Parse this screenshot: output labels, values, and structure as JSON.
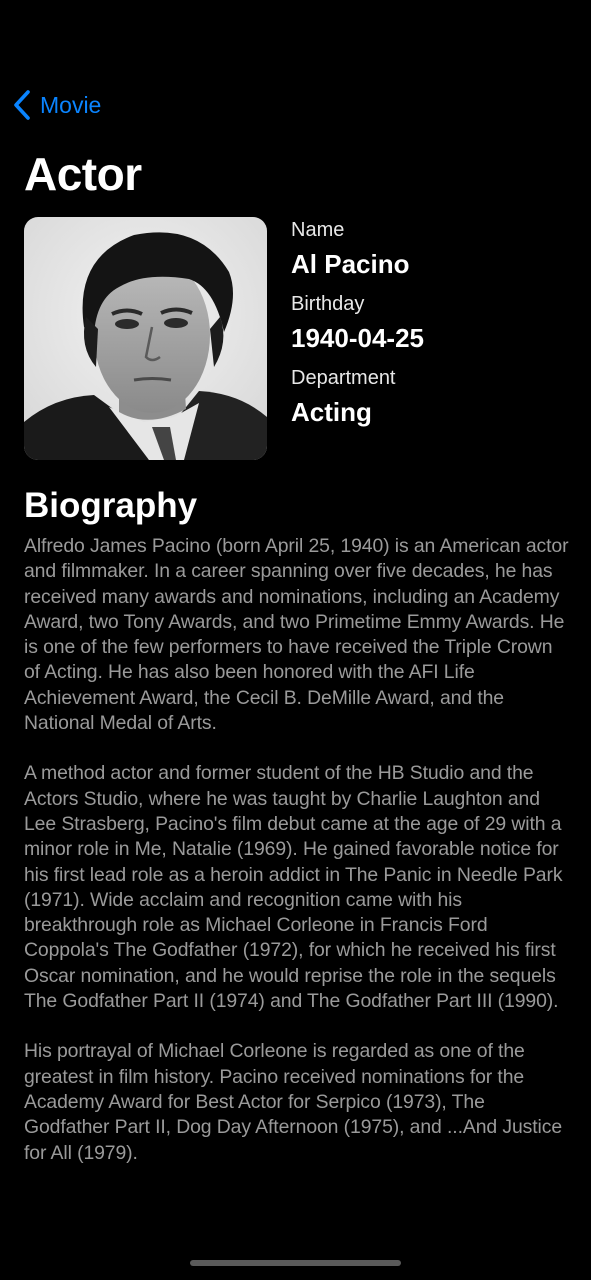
{
  "nav": {
    "back_label": "Movie"
  },
  "page": {
    "title": "Actor"
  },
  "actor": {
    "photo_alt": "Al Pacino",
    "name_label": "Name",
    "name": "Al Pacino",
    "birthday_label": "Birthday",
    "birthday": "1940-04-25",
    "department_label": "Department",
    "department": "Acting"
  },
  "biography": {
    "heading": "Biography",
    "paragraphs": [
      "Alfredo James Pacino (born April 25, 1940) is an American actor and filmmaker. In a career spanning over five decades, he has received many awards and nominations, including an Academy Award, two Tony Awards, and two Primetime Emmy Awards. He is one of the few performers to have received the Triple Crown of Acting. He has also been honored with the AFI Life Achievement Award, the Cecil B. DeMille Award, and the National Medal of Arts.",
      "A method actor and former student of the HB Studio and the Actors Studio, where he was taught by Charlie Laughton and Lee Strasberg, Pacino's film debut came at the age of 29 with a minor role in Me, Natalie (1969). He gained favorable notice for his first lead role as a heroin addict in The Panic in Needle Park (1971). Wide acclaim and recognition came with his breakthrough role as Michael Corleone in Francis Ford Coppola's The Godfather (1972), for which he received his first Oscar nomination, and he would reprise the role in the sequels The Godfather Part II (1974) and The Godfather Part III (1990).",
      "His portrayal of Michael Corleone is regarded as one of the greatest in film history. Pacino received nominations for the Academy Award for Best Actor for Serpico (1973), The Godfather Part II, Dog Day Afternoon (1975), and ...And Justice for All (1979)."
    ]
  },
  "colors": {
    "accent": "#0a84ff",
    "background": "#000000",
    "body_text": "#9a9a9a"
  },
  "icons": {
    "back": "chevron-left-icon"
  }
}
